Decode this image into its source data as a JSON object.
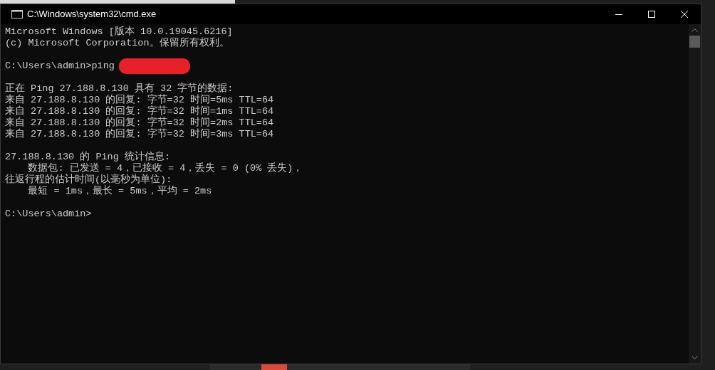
{
  "window": {
    "title": "C:\\Windows\\system32\\cmd.exe"
  },
  "console": [
    {
      "kind": "text",
      "text": "Microsoft Windows [版本 10.0.19045.6216]"
    },
    {
      "kind": "text",
      "text": "(c) Microsoft Corporation。保留所有权利。"
    },
    {
      "kind": "blank"
    },
    {
      "kind": "redacted",
      "text": "C:\\Users\\admin>ping"
    },
    {
      "kind": "blank"
    },
    {
      "kind": "text",
      "text": "正在 Ping 27.188.8.130 具有 32 字节的数据:"
    },
    {
      "kind": "text",
      "text": "来自 27.188.8.130 的回复: 字节=32 时间=5ms TTL=64"
    },
    {
      "kind": "text",
      "text": "来自 27.188.8.130 的回复: 字节=32 时间=1ms TTL=64"
    },
    {
      "kind": "text",
      "text": "来自 27.188.8.130 的回复: 字节=32 时间=2ms TTL=64"
    },
    {
      "kind": "text",
      "text": "来自 27.188.8.130 的回复: 字节=32 时间=3ms TTL=64"
    },
    {
      "kind": "blank"
    },
    {
      "kind": "text",
      "text": "27.188.8.130 的 Ping 统计信息:"
    },
    {
      "kind": "text",
      "text": "    数据包: 已发送 = 4，已接收 = 4，丢失 = 0 (0% 丢失)，"
    },
    {
      "kind": "text",
      "text": "往返行程的估计时间(以毫秒为单位):"
    },
    {
      "kind": "text",
      "text": "    最短 = 1ms，最长 = 5ms，平均 = 2ms"
    },
    {
      "kind": "blank"
    },
    {
      "kind": "text",
      "text": "C:\\Users\\admin>"
    }
  ]
}
